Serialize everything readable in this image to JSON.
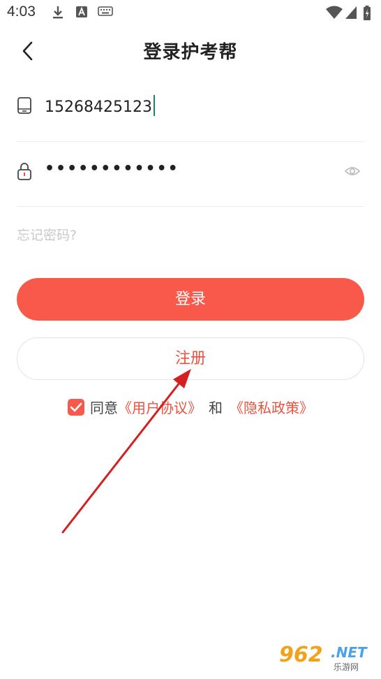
{
  "status_bar": {
    "time": "4:03",
    "icons": [
      "download-icon",
      "font-app-icon",
      "keyboard-icon",
      "wifi-icon",
      "signal-icon",
      "battery-icon"
    ]
  },
  "header": {
    "title": "登录护考帮",
    "back_icon": "chevron-left-icon"
  },
  "login_form": {
    "phone": {
      "icon": "tablet-icon",
      "value": "15268425123"
    },
    "password": {
      "icon": "lock-icon",
      "value": "••••••••••••",
      "toggle_icon": "eye-icon"
    },
    "forgot_password": "忘记密码?"
  },
  "buttons": {
    "login": "登录",
    "register": "注册"
  },
  "agreement": {
    "checked": true,
    "prefix": "同意",
    "user_agreement": "《用户协议》",
    "and": "和",
    "privacy_policy": "《隐私政策》"
  },
  "colors": {
    "accent": "#f9594a",
    "link": "#e8533f",
    "annotation_arrow": "#d32020"
  },
  "watermark": {
    "main": "962",
    "net": ".NET",
    "sub": "乐游网"
  }
}
